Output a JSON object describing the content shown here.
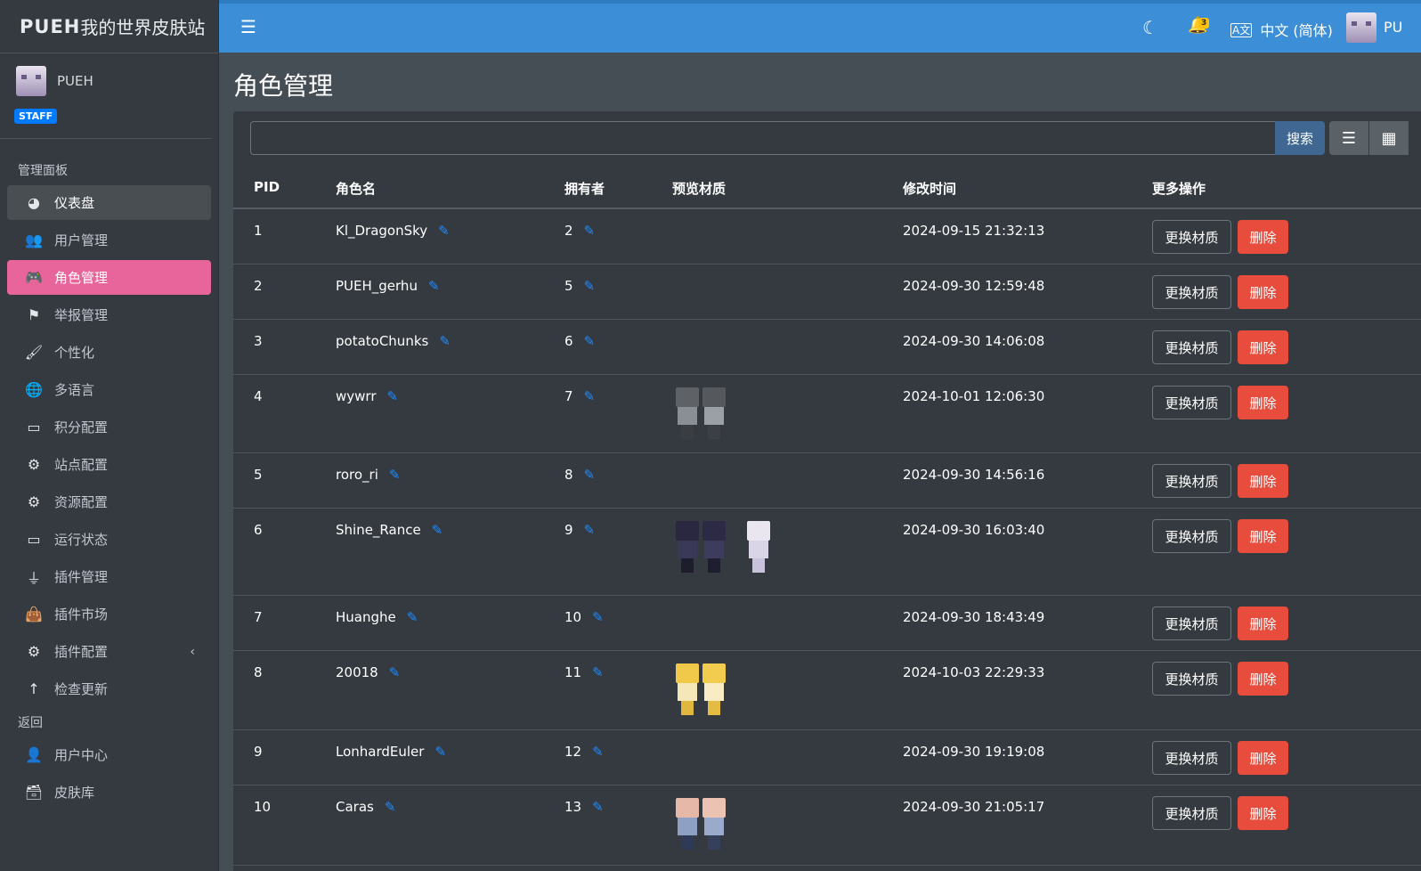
{
  "app": {
    "brand_prefix": "PUEH",
    "brand_suffix": "我的世界皮肤站"
  },
  "user": {
    "name": "PUEH",
    "badge": "STAFF"
  },
  "sidebar": {
    "section_admin": "管理面板",
    "items": [
      {
        "label": "仪表盘",
        "icon": "dashboard-icon"
      },
      {
        "label": "用户管理",
        "icon": "users-icon"
      },
      {
        "label": "角色管理",
        "icon": "gamepad-icon"
      },
      {
        "label": "举报管理",
        "icon": "flag-icon"
      },
      {
        "label": "个性化",
        "icon": "brush-icon"
      },
      {
        "label": "多语言",
        "icon": "globe-icon"
      },
      {
        "label": "积分配置",
        "icon": "credit-card-icon"
      },
      {
        "label": "站点配置",
        "icon": "cog-icon"
      },
      {
        "label": "资源配置",
        "icon": "cog-outline-icon"
      },
      {
        "label": "运行状态",
        "icon": "battery-icon"
      },
      {
        "label": "插件管理",
        "icon": "plug-icon"
      },
      {
        "label": "插件市场",
        "icon": "shopping-bag-icon"
      },
      {
        "label": "插件配置",
        "icon": "cogs-icon"
      },
      {
        "label": "检查更新",
        "icon": "arrow-up-icon"
      }
    ],
    "section_back": "返回",
    "back_items": [
      {
        "label": "用户中心",
        "icon": "user-icon"
      },
      {
        "label": "皮肤库",
        "icon": "archive-icon"
      }
    ]
  },
  "topbar": {
    "notification_count": "3",
    "language": "中文 (简体)",
    "user_label": "PU"
  },
  "page": {
    "title": "角色管理",
    "search_placeholder": "",
    "search_button": "搜索"
  },
  "table": {
    "headers": {
      "pid": "PID",
      "name": "角色名",
      "owner": "拥有者",
      "preview": "预览材质",
      "modified": "修改时间",
      "actions": "更多操作"
    },
    "change_label": "更换材质",
    "delete_label": "删除",
    "rows": [
      {
        "pid": "1",
        "name": "Kl_DragonSky",
        "owner": "2",
        "modified": "2024-09-15 21:32:13"
      },
      {
        "pid": "2",
        "name": "PUEH_gerhu",
        "owner": "5",
        "modified": "2024-09-30 12:59:48"
      },
      {
        "pid": "3",
        "name": "potatoChunks",
        "owner": "6",
        "modified": "2024-09-30 14:06:08"
      },
      {
        "pid": "4",
        "name": "wywrr",
        "owner": "7",
        "modified": "2024-10-01 12:06:30"
      },
      {
        "pid": "5",
        "name": "roro_ri",
        "owner": "8",
        "modified": "2024-09-30 14:56:16"
      },
      {
        "pid": "6",
        "name": "Shine_Rance",
        "owner": "9",
        "modified": "2024-09-30 16:03:40"
      },
      {
        "pid": "7",
        "name": "Huanghe",
        "owner": "10",
        "modified": "2024-09-30 18:43:49"
      },
      {
        "pid": "8",
        "name": "20018",
        "owner": "11",
        "modified": "2024-10-03 22:29:33"
      },
      {
        "pid": "9",
        "name": "LonhardEuler",
        "owner": "12",
        "modified": "2024-09-30 19:19:08"
      },
      {
        "pid": "10",
        "name": "Caras",
        "owner": "13",
        "modified": "2024-09-30 21:05:17"
      }
    ]
  },
  "colors": {
    "topbar": "#3c8fd6",
    "active_pink": "#e8659b",
    "danger": "#e74c3c",
    "edit_blue": "#1e8bff",
    "search_btn": "#3f6791"
  }
}
